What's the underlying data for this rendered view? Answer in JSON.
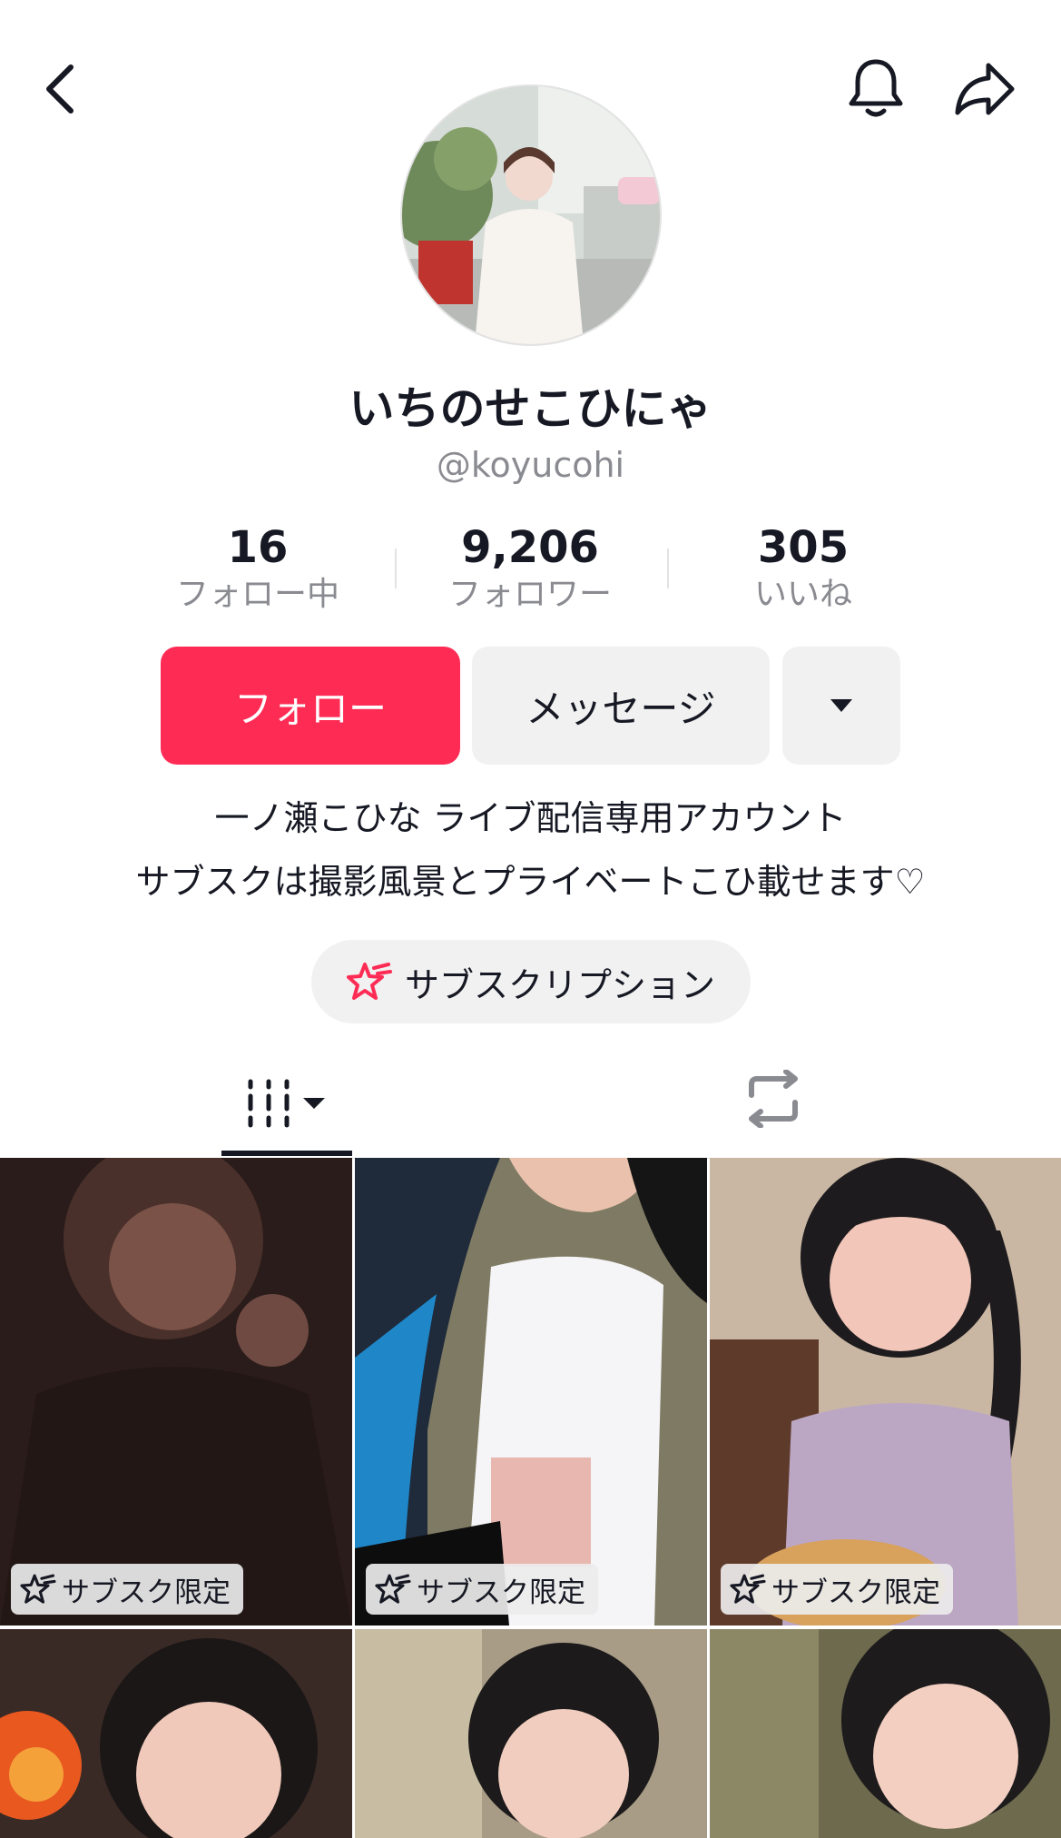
{
  "profile": {
    "display_name": "いちのせこひにゃ",
    "handle": "@koyucohi"
  },
  "stats": {
    "following": {
      "value": "16",
      "label": "フォロー中"
    },
    "followers": {
      "value": "9,206",
      "label": "フォロワー"
    },
    "likes": {
      "value": "305",
      "label": "いいね"
    }
  },
  "actions": {
    "follow_label": "フォロー",
    "message_label": "メッセージ"
  },
  "bio": {
    "line1": "一ノ瀬こひな ライブ配信専用アカウント",
    "line2": "サブスクは撮影風景とプライベートこひ載せます♡"
  },
  "subscription": {
    "label": "サブスクリプション"
  },
  "grid": {
    "badge_label": "サブスク限定",
    "tiles": [
      {
        "badge": "サブスク限定"
      },
      {
        "badge": "サブスク限定"
      },
      {
        "badge": "サブスク限定"
      },
      {
        "badge": ""
      },
      {
        "badge": ""
      },
      {
        "badge": ""
      }
    ]
  },
  "colors": {
    "accent": "#fe2c55",
    "secondary_bg": "#f1f1f2",
    "muted_text": "#8a8b91"
  },
  "icons": [
    "back-icon",
    "bell-icon",
    "share-icon",
    "dropdown-arrow-icon",
    "subscription-star-icon",
    "videos-grid-icon",
    "repost-icon"
  ]
}
